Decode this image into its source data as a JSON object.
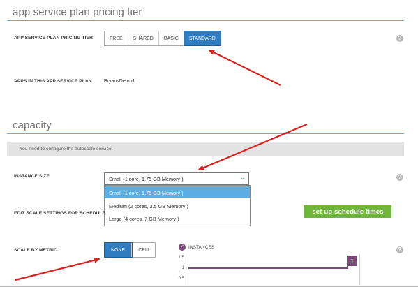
{
  "pricing": {
    "section_title": "app service plan pricing tier",
    "tier_label": "APP SERVICE PLAN PRICING TIER",
    "tiers": [
      "FREE",
      "SHARED",
      "BASIC",
      "STANDARD"
    ],
    "active_tier": "STANDARD",
    "apps_label": "APPS IN THIS APP SERVICE PLAN",
    "apps_value": "BryansDemo1"
  },
  "capacity": {
    "section_title": "capacity",
    "banner": "You need to configure the autoscale service.",
    "instance_size_label": "INSTANCE SIZE",
    "instance_size_value": "Small (1 core, 1.75 GB Memory )",
    "instance_size_options": [
      "Small (1 core, 1.75 GB Memory )",
      "Medium (2 cores, 3.5 GB Memory )",
      "Large (4 cores, 7 GB Memory )"
    ],
    "edit_schedule_label": "EDIT SCALE SETTINGS FOR SCHEDULE",
    "schedule_button": "set up schedule times",
    "scale_by_metric_label": "SCALE BY METRIC",
    "metric_options": [
      "NONE",
      "CPU"
    ],
    "active_metric": "NONE"
  },
  "chart": {
    "legend": "INSTANCES",
    "badge": "1"
  },
  "chart_data": {
    "type": "line",
    "series": [
      {
        "name": "INSTANCES",
        "values": [
          1,
          1
        ]
      }
    ],
    "y_ticks": [
      "1.5",
      "1",
      "0.5"
    ],
    "ylim": [
      0.5,
      1.5
    ]
  },
  "help_icon": "?",
  "colors": {
    "accent": "#2f7dc0",
    "green": "#70b53c",
    "arrow": "#d9211f",
    "series": "#7a4a7a"
  }
}
